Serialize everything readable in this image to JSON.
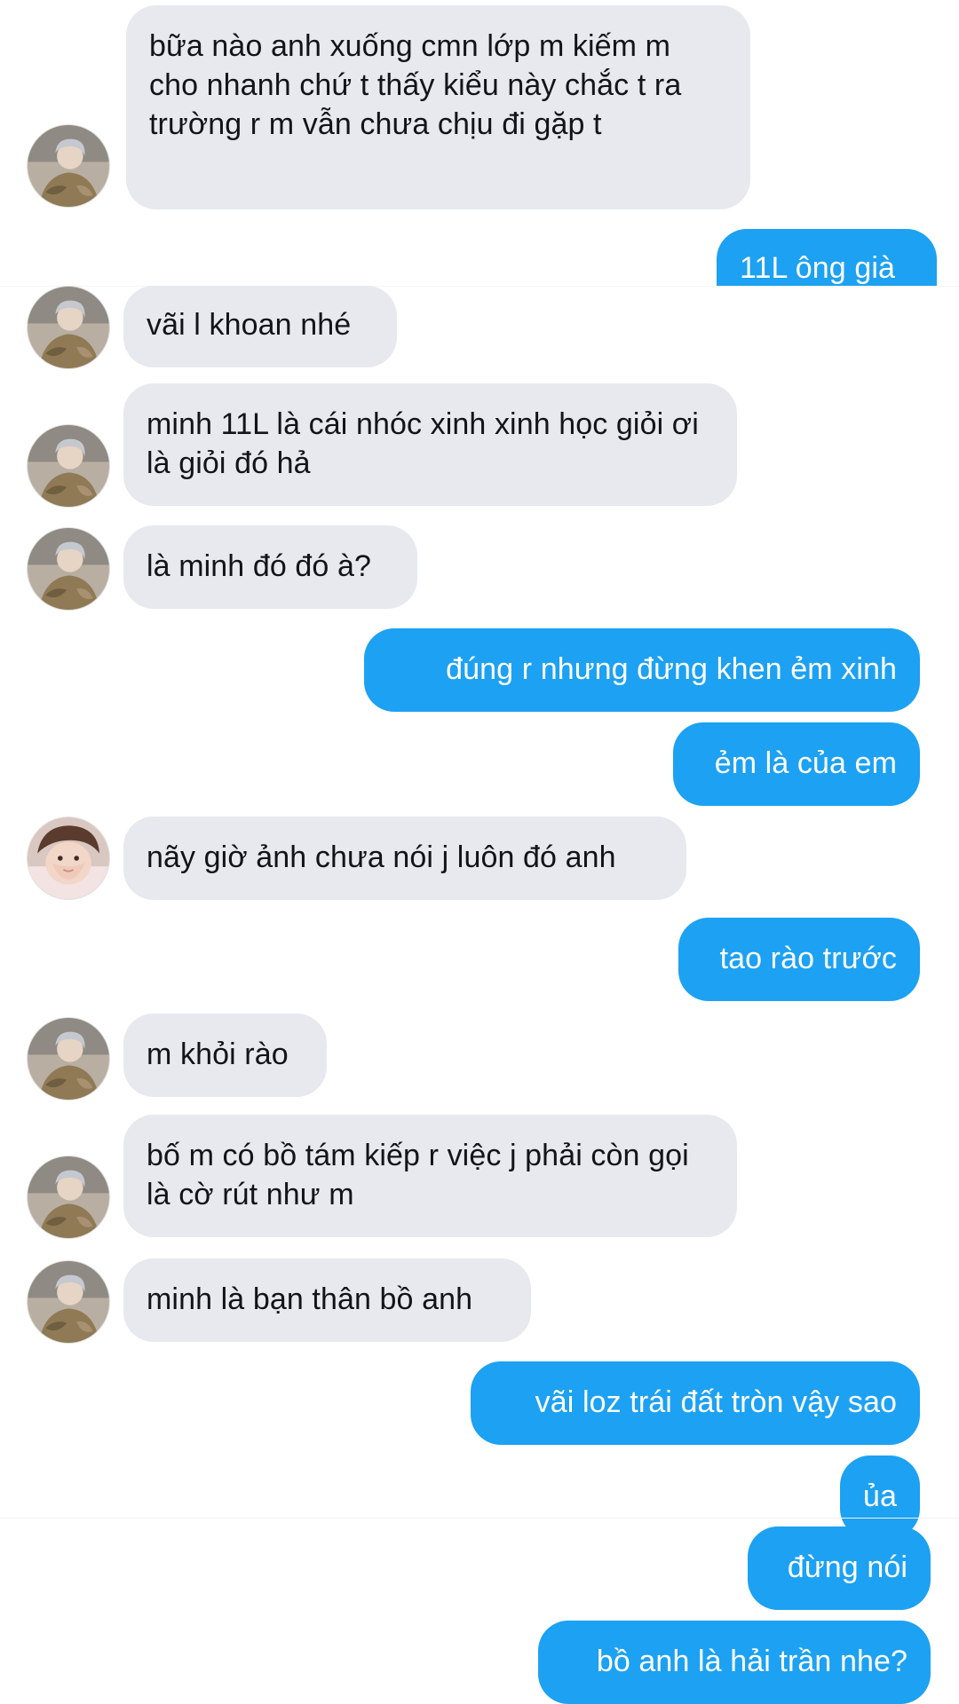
{
  "colors": {
    "incoming_bubble": "#e7e9ee",
    "outgoing_bubble": "#1da1f2",
    "incoming_text": "#111418",
    "outgoing_text": "#ffffff"
  },
  "messages": [
    {
      "text": "bữa nào anh xuống cmn lớp m kiếm m cho nhanh chứ t thấy kiểu này chắc t ra trường r m vẫn chưa chịu đi gặp t",
      "avatar": "friend-avatar-a"
    },
    {
      "text": "11L ông già"
    },
    {
      "text": "vãi l khoan nhé",
      "avatar": "friend-avatar-a"
    },
    {
      "text": "minh 11L là cái nhóc xinh xinh học giỏi ơi là giỏi đó hả",
      "avatar": "friend-avatar-a"
    },
    {
      "text": "là minh đó đó à?",
      "avatar": "friend-avatar-a"
    },
    {
      "text": "đúng r nhưng đừng khen ẻm xinh"
    },
    {
      "text": "ẻm là của em"
    },
    {
      "text": "nãy giờ ảnh chưa nói j luôn đó anh",
      "avatar": "friend-avatar-b"
    },
    {
      "text": "tao rào trước"
    },
    {
      "text": "m khỏi rào",
      "avatar": "friend-avatar-a"
    },
    {
      "text": "bố m có bồ tám kiếp r việc j phải còn gọi là cờ rút như m",
      "avatar": "friend-avatar-a"
    },
    {
      "text": "minh là bạn thân bồ anh",
      "avatar": "friend-avatar-a"
    },
    {
      "text": "vãi loz trái đất tròn vậy sao"
    },
    {
      "text": "ủa"
    },
    {
      "text": "đừng nói"
    },
    {
      "text": "bồ anh là hải trần nhe?"
    }
  ]
}
